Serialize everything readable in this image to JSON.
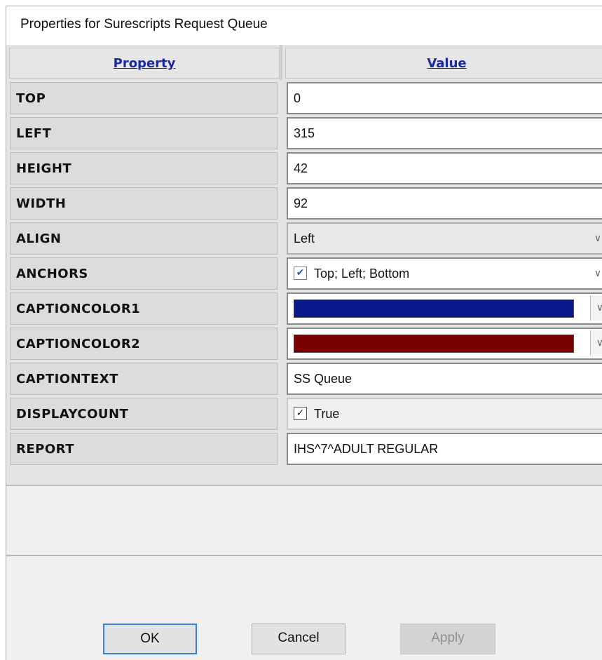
{
  "window": {
    "title": "Properties for Surescripts Request Queue"
  },
  "grid": {
    "columns": {
      "property": "Property",
      "value": "Value"
    },
    "rows": [
      {
        "property": "TOP",
        "value": "0",
        "kind": "text"
      },
      {
        "property": "LEFT",
        "value": "315",
        "kind": "text"
      },
      {
        "property": "HEIGHT",
        "value": "42",
        "kind": "text"
      },
      {
        "property": "WIDTH",
        "value": "92",
        "kind": "text"
      },
      {
        "property": "ALIGN",
        "value": "Left",
        "kind": "dropdown"
      },
      {
        "property": "ANCHORS",
        "value": "Top; Left; Bottom",
        "kind": "checked-dropdown"
      },
      {
        "property": "CAPTIONCOLOR1",
        "value": "#0a1a8a",
        "kind": "color"
      },
      {
        "property": "CAPTIONCOLOR2",
        "value": "#7a0000",
        "kind": "color"
      },
      {
        "property": "CAPTIONTEXT",
        "value": "SS Queue",
        "kind": "text"
      },
      {
        "property": "DISPLAYCOUNT",
        "value": "True",
        "kind": "checkbox"
      },
      {
        "property": "REPORT",
        "value": "IHS^7^ADULT REGULAR",
        "kind": "text"
      }
    ]
  },
  "buttons": {
    "ok": "OK",
    "cancel": "Cancel",
    "apply": "Apply"
  },
  "icons": {
    "chevron": "chevron-down-icon",
    "check": "checkmark-icon"
  }
}
